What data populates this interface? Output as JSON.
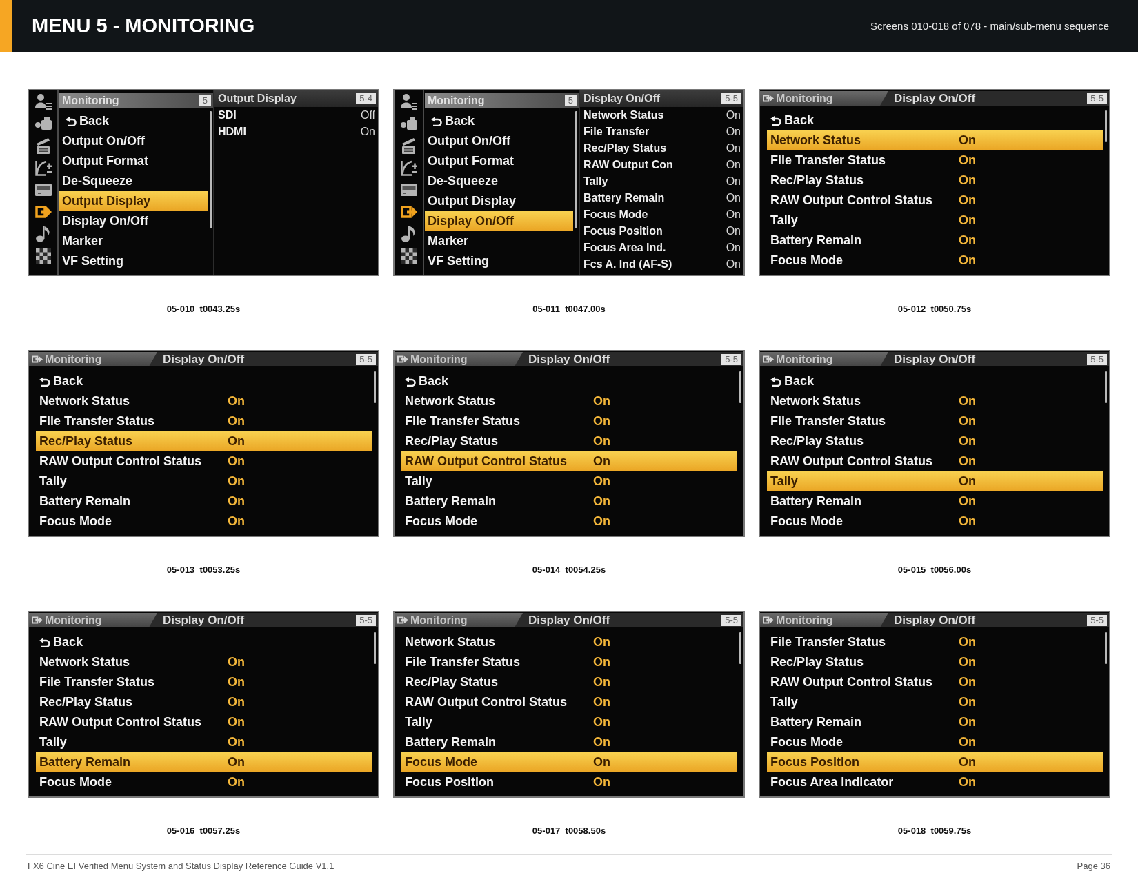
{
  "header": {
    "title": "MENU 5 - MONITORING",
    "subtitle": "Screens 010-018 of 078 - main/sub-menu sequence"
  },
  "screens": [
    {
      "kind": "split",
      "caption": "05-010  t0043.25s",
      "category_icons": [
        {
          "selected": false
        },
        {
          "selected": false
        },
        {
          "selected": false
        },
        {
          "selected": false
        },
        {
          "selected": false
        },
        {
          "selected": true
        },
        {
          "selected": false
        },
        {
          "selected": false
        }
      ],
      "menu": {
        "title": "Monitoring",
        "page": "5",
        "items": [
          {
            "kind": "back",
            "label": "Back",
            "selected": false
          },
          {
            "kind": "setting",
            "label": "Output On/Off",
            "selected": false
          },
          {
            "kind": "setting",
            "label": "Output Format",
            "selected": false
          },
          {
            "kind": "setting",
            "label": "De-Squeeze",
            "selected": false
          },
          {
            "kind": "setting",
            "label": "Output Display",
            "selected": true
          },
          {
            "kind": "setting",
            "label": "Display On/Off",
            "selected": false
          },
          {
            "kind": "setting",
            "label": "Marker",
            "selected": false
          },
          {
            "kind": "setting",
            "label": "VF Setting",
            "selected": false
          }
        ]
      },
      "submenu": {
        "title": "Output Display",
        "page": "5-4",
        "rows": [
          {
            "label": "SDI",
            "value": "Off"
          },
          {
            "label": "HDMI",
            "value": "On"
          }
        ]
      }
    },
    {
      "kind": "split",
      "caption": "05-011  t0047.00s",
      "category_icons": [
        {
          "selected": false
        },
        {
          "selected": false
        },
        {
          "selected": false
        },
        {
          "selected": false
        },
        {
          "selected": false
        },
        {
          "selected": true
        },
        {
          "selected": false
        },
        {
          "selected": false
        }
      ],
      "menu": {
        "title": "Monitoring",
        "page": "5",
        "items": [
          {
            "kind": "back",
            "label": "Back",
            "selected": false
          },
          {
            "kind": "setting",
            "label": "Output On/Off",
            "selected": false
          },
          {
            "kind": "setting",
            "label": "Output Format",
            "selected": false
          },
          {
            "kind": "setting",
            "label": "De-Squeeze",
            "selected": false
          },
          {
            "kind": "setting",
            "label": "Output Display",
            "selected": false
          },
          {
            "kind": "setting",
            "label": "Display On/Off",
            "selected": true
          },
          {
            "kind": "setting",
            "label": "Marker",
            "selected": false
          },
          {
            "kind": "setting",
            "label": "VF Setting",
            "selected": false
          }
        ]
      },
      "submenu": {
        "title": "Display On/Off",
        "page": "5-5",
        "rows": [
          {
            "label": "Network Status",
            "value": "On"
          },
          {
            "label": "File Transfer",
            "value": "On"
          },
          {
            "label": "Rec/Play Status",
            "value": "On"
          },
          {
            "label": "RAW Output Con",
            "value": "On"
          },
          {
            "label": "Tally",
            "value": "On"
          },
          {
            "label": "Battery Remain",
            "value": "On"
          },
          {
            "label": "Focus Mode",
            "value": "On"
          },
          {
            "label": "Focus Position",
            "value": "On"
          },
          {
            "label": "Focus Area Ind.",
            "value": "On"
          },
          {
            "label": "Fcs A. Ind (AF-S)",
            "value": "On"
          }
        ]
      }
    },
    {
      "kind": "full",
      "caption": "05-012  t0050.75s",
      "breadcrumb": "Monitoring",
      "title": "Display On/Off",
      "page": "5-5",
      "rows": [
        {
          "kind": "back",
          "label": "Back",
          "selected": false
        },
        {
          "kind": "setting",
          "label": "Network Status",
          "value": "On",
          "selected": true
        },
        {
          "kind": "setting",
          "label": "File Transfer Status",
          "value": "On",
          "selected": false
        },
        {
          "kind": "setting",
          "label": "Rec/Play Status",
          "value": "On",
          "selected": false
        },
        {
          "kind": "setting",
          "label": "RAW Output Control Status",
          "value": "On",
          "selected": false
        },
        {
          "kind": "setting",
          "label": "Tally",
          "value": "On",
          "selected": false
        },
        {
          "kind": "setting",
          "label": "Battery Remain",
          "value": "On",
          "selected": false
        },
        {
          "kind": "setting",
          "label": "Focus Mode",
          "value": "On",
          "selected": false
        }
      ]
    },
    {
      "kind": "full",
      "caption": "05-013  t0053.25s",
      "breadcrumb": "Monitoring",
      "title": "Display On/Off",
      "page": "5-5",
      "rows": [
        {
          "kind": "back",
          "label": "Back",
          "selected": false
        },
        {
          "kind": "setting",
          "label": "Network Status",
          "value": "On",
          "selected": false
        },
        {
          "kind": "setting",
          "label": "File Transfer Status",
          "value": "On",
          "selected": false
        },
        {
          "kind": "setting",
          "label": "Rec/Play Status",
          "value": "On",
          "selected": true
        },
        {
          "kind": "setting",
          "label": "RAW Output Control Status",
          "value": "On",
          "selected": false
        },
        {
          "kind": "setting",
          "label": "Tally",
          "value": "On",
          "selected": false
        },
        {
          "kind": "setting",
          "label": "Battery Remain",
          "value": "On",
          "selected": false
        },
        {
          "kind": "setting",
          "label": "Focus Mode",
          "value": "On",
          "selected": false
        }
      ]
    },
    {
      "kind": "full",
      "caption": "05-014  t0054.25s",
      "breadcrumb": "Monitoring",
      "title": "Display On/Off",
      "page": "5-5",
      "rows": [
        {
          "kind": "back",
          "label": "Back",
          "selected": false
        },
        {
          "kind": "setting",
          "label": "Network Status",
          "value": "On",
          "selected": false
        },
        {
          "kind": "setting",
          "label": "File Transfer Status",
          "value": "On",
          "selected": false
        },
        {
          "kind": "setting",
          "label": "Rec/Play Status",
          "value": "On",
          "selected": false
        },
        {
          "kind": "setting",
          "label": "RAW Output Control Status",
          "value": "On",
          "selected": true
        },
        {
          "kind": "setting",
          "label": "Tally",
          "value": "On",
          "selected": false
        },
        {
          "kind": "setting",
          "label": "Battery Remain",
          "value": "On",
          "selected": false
        },
        {
          "kind": "setting",
          "label": "Focus Mode",
          "value": "On",
          "selected": false
        }
      ]
    },
    {
      "kind": "full",
      "caption": "05-015  t0056.00s",
      "breadcrumb": "Monitoring",
      "title": "Display On/Off",
      "page": "5-5",
      "rows": [
        {
          "kind": "back",
          "label": "Back",
          "selected": false
        },
        {
          "kind": "setting",
          "label": "Network Status",
          "value": "On",
          "selected": false
        },
        {
          "kind": "setting",
          "label": "File Transfer Status",
          "value": "On",
          "selected": false
        },
        {
          "kind": "setting",
          "label": "Rec/Play Status",
          "value": "On",
          "selected": false
        },
        {
          "kind": "setting",
          "label": "RAW Output Control Status",
          "value": "On",
          "selected": false
        },
        {
          "kind": "setting",
          "label": "Tally",
          "value": "On",
          "selected": true
        },
        {
          "kind": "setting",
          "label": "Battery Remain",
          "value": "On",
          "selected": false
        },
        {
          "kind": "setting",
          "label": "Focus Mode",
          "value": "On",
          "selected": false
        }
      ]
    },
    {
      "kind": "full",
      "caption": "05-016  t0057.25s",
      "breadcrumb": "Monitoring",
      "title": "Display On/Off",
      "page": "5-5",
      "rows": [
        {
          "kind": "back",
          "label": "Back",
          "selected": false
        },
        {
          "kind": "setting",
          "label": "Network Status",
          "value": "On",
          "selected": false
        },
        {
          "kind": "setting",
          "label": "File Transfer Status",
          "value": "On",
          "selected": false
        },
        {
          "kind": "setting",
          "label": "Rec/Play Status",
          "value": "On",
          "selected": false
        },
        {
          "kind": "setting",
          "label": "RAW Output Control Status",
          "value": "On",
          "selected": false
        },
        {
          "kind": "setting",
          "label": "Tally",
          "value": "On",
          "selected": false
        },
        {
          "kind": "setting",
          "label": "Battery Remain",
          "value": "On",
          "selected": true
        },
        {
          "kind": "setting",
          "label": "Focus Mode",
          "value": "On",
          "selected": false
        }
      ]
    },
    {
      "kind": "full",
      "caption": "05-017  t0058.50s",
      "breadcrumb": "Monitoring",
      "title": "Display On/Off",
      "page": "5-5",
      "rows": [
        {
          "kind": "setting",
          "label": "Network Status",
          "value": "On",
          "selected": false
        },
        {
          "kind": "setting",
          "label": "File Transfer Status",
          "value": "On",
          "selected": false
        },
        {
          "kind": "setting",
          "label": "Rec/Play Status",
          "value": "On",
          "selected": false
        },
        {
          "kind": "setting",
          "label": "RAW Output Control Status",
          "value": "On",
          "selected": false
        },
        {
          "kind": "setting",
          "label": "Tally",
          "value": "On",
          "selected": false
        },
        {
          "kind": "setting",
          "label": "Battery Remain",
          "value": "On",
          "selected": false
        },
        {
          "kind": "setting",
          "label": "Focus Mode",
          "value": "On",
          "selected": true
        },
        {
          "kind": "setting",
          "label": "Focus Position",
          "value": "On",
          "selected": false
        }
      ]
    },
    {
      "kind": "full",
      "caption": "05-018  t0059.75s",
      "breadcrumb": "Monitoring",
      "title": "Display On/Off",
      "page": "5-5",
      "rows": [
        {
          "kind": "setting",
          "label": "File Transfer Status",
          "value": "On",
          "selected": false
        },
        {
          "kind": "setting",
          "label": "Rec/Play Status",
          "value": "On",
          "selected": false
        },
        {
          "kind": "setting",
          "label": "RAW Output Control Status",
          "value": "On",
          "selected": false
        },
        {
          "kind": "setting",
          "label": "Tally",
          "value": "On",
          "selected": false
        },
        {
          "kind": "setting",
          "label": "Battery Remain",
          "value": "On",
          "selected": false
        },
        {
          "kind": "setting",
          "label": "Focus Mode",
          "value": "On",
          "selected": false
        },
        {
          "kind": "setting",
          "label": "Focus Position",
          "value": "On",
          "selected": true
        },
        {
          "kind": "setting",
          "label": "Focus Area Indicator",
          "value": "On",
          "selected": false
        }
      ]
    }
  ],
  "footer": {
    "text": "FX6 Cine EI Verified Menu System and Status Display Reference Guide V1.1",
    "page": "Page 36"
  }
}
